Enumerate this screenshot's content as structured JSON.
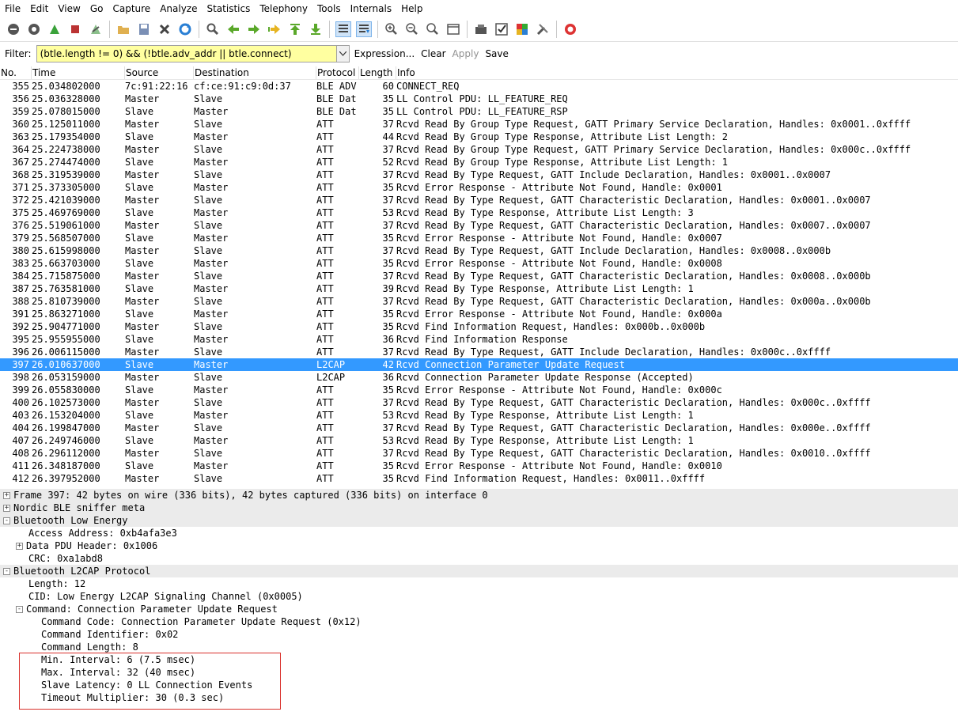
{
  "menu": [
    "File",
    "Edit",
    "View",
    "Go",
    "Capture",
    "Analyze",
    "Statistics",
    "Telephony",
    "Tools",
    "Internals",
    "Help"
  ],
  "toolbar_icons": [
    "interface-list-icon",
    "capture-options-icon",
    "start-capture-icon",
    "stop-capture-icon",
    "restart-capture-icon",
    "open-file-icon",
    "save-file-icon",
    "close-file-icon",
    "reload-icon",
    "find-icon",
    "go-back-icon",
    "go-forward-icon",
    "go-to-packet-icon",
    "first-packet-icon",
    "last-packet-icon",
    "colorize-icon",
    "autoscroll-icon",
    "zoom-in-icon",
    "zoom-out-icon",
    "normal-size-icon",
    "resize-columns-icon",
    "capture-filters-icon",
    "display-filters-icon",
    "coloring-rules-icon",
    "preferences-icon",
    "help-icon"
  ],
  "filter": {
    "label": "Filter:",
    "value": "(btle.length != 0) && (!btle.adv_addr || btle.connect)",
    "expression": "Expression...",
    "clear": "Clear",
    "apply": "Apply",
    "save": "Save"
  },
  "columns": {
    "no": "No.",
    "time": "Time",
    "source": "Source",
    "destination": "Destination",
    "protocol": "Protocol",
    "length": "Length",
    "info": "Info"
  },
  "packets": [
    {
      "no": "355",
      "time": "25.034802000",
      "src": "7c:91:22:16",
      "dst": "cf:ce:91:c9:0d:37",
      "proto": "BLE ADV",
      "len": "60",
      "info": "CONNECT_REQ"
    },
    {
      "no": "356",
      "time": "25.036328000",
      "src": "Master",
      "dst": "Slave",
      "proto": "BLE Dat",
      "len": "35",
      "info": "LL Control PDU: LL_FEATURE_REQ"
    },
    {
      "no": "359",
      "time": "25.078015000",
      "src": "Slave",
      "dst": "Master",
      "proto": "BLE Dat",
      "len": "35",
      "info": "LL Control PDU: LL_FEATURE_RSP"
    },
    {
      "no": "360",
      "time": "25.125011000",
      "src": "Master",
      "dst": "Slave",
      "proto": "ATT",
      "len": "37",
      "info": "Rcvd Read By Group Type Request, GATT Primary Service Declaration, Handles: 0x0001..0xffff"
    },
    {
      "no": "363",
      "time": "25.179354000",
      "src": "Slave",
      "dst": "Master",
      "proto": "ATT",
      "len": "44",
      "info": "Rcvd Read By Group Type Response, Attribute List Length: 2"
    },
    {
      "no": "364",
      "time": "25.224738000",
      "src": "Master",
      "dst": "Slave",
      "proto": "ATT",
      "len": "37",
      "info": "Rcvd Read By Group Type Request, GATT Primary Service Declaration, Handles: 0x000c..0xffff"
    },
    {
      "no": "367",
      "time": "25.274474000",
      "src": "Slave",
      "dst": "Master",
      "proto": "ATT",
      "len": "52",
      "info": "Rcvd Read By Group Type Response, Attribute List Length: 1"
    },
    {
      "no": "368",
      "time": "25.319539000",
      "src": "Master",
      "dst": "Slave",
      "proto": "ATT",
      "len": "37",
      "info": "Rcvd Read By Type Request, GATT Include Declaration, Handles: 0x0001..0x0007"
    },
    {
      "no": "371",
      "time": "25.373305000",
      "src": "Slave",
      "dst": "Master",
      "proto": "ATT",
      "len": "35",
      "info": "Rcvd Error Response - Attribute Not Found, Handle: 0x0001"
    },
    {
      "no": "372",
      "time": "25.421039000",
      "src": "Master",
      "dst": "Slave",
      "proto": "ATT",
      "len": "37",
      "info": "Rcvd Read By Type Request, GATT Characteristic Declaration, Handles: 0x0001..0x0007"
    },
    {
      "no": "375",
      "time": "25.469769000",
      "src": "Slave",
      "dst": "Master",
      "proto": "ATT",
      "len": "53",
      "info": "Rcvd Read By Type Response, Attribute List Length: 3"
    },
    {
      "no": "376",
      "time": "25.519061000",
      "src": "Master",
      "dst": "Slave",
      "proto": "ATT",
      "len": "37",
      "info": "Rcvd Read By Type Request, GATT Characteristic Declaration, Handles: 0x0007..0x0007"
    },
    {
      "no": "379",
      "time": "25.568507000",
      "src": "Slave",
      "dst": "Master",
      "proto": "ATT",
      "len": "35",
      "info": "Rcvd Error Response - Attribute Not Found, Handle: 0x0007"
    },
    {
      "no": "380",
      "time": "25.615998000",
      "src": "Master",
      "dst": "Slave",
      "proto": "ATT",
      "len": "37",
      "info": "Rcvd Read By Type Request, GATT Include Declaration, Handles: 0x0008..0x000b"
    },
    {
      "no": "383",
      "time": "25.663703000",
      "src": "Slave",
      "dst": "Master",
      "proto": "ATT",
      "len": "35",
      "info": "Rcvd Error Response - Attribute Not Found, Handle: 0x0008"
    },
    {
      "no": "384",
      "time": "25.715875000",
      "src": "Master",
      "dst": "Slave",
      "proto": "ATT",
      "len": "37",
      "info": "Rcvd Read By Type Request, GATT Characteristic Declaration, Handles: 0x0008..0x000b"
    },
    {
      "no": "387",
      "time": "25.763581000",
      "src": "Slave",
      "dst": "Master",
      "proto": "ATT",
      "len": "39",
      "info": "Rcvd Read By Type Response, Attribute List Length: 1"
    },
    {
      "no": "388",
      "time": "25.810739000",
      "src": "Master",
      "dst": "Slave",
      "proto": "ATT",
      "len": "37",
      "info": "Rcvd Read By Type Request, GATT Characteristic Declaration, Handles: 0x000a..0x000b"
    },
    {
      "no": "391",
      "time": "25.863271000",
      "src": "Slave",
      "dst": "Master",
      "proto": "ATT",
      "len": "35",
      "info": "Rcvd Error Response - Attribute Not Found, Handle: 0x000a"
    },
    {
      "no": "392",
      "time": "25.904771000",
      "src": "Master",
      "dst": "Slave",
      "proto": "ATT",
      "len": "35",
      "info": "Rcvd Find Information Request, Handles: 0x000b..0x000b"
    },
    {
      "no": "395",
      "time": "25.955955000",
      "src": "Slave",
      "dst": "Master",
      "proto": "ATT",
      "len": "36",
      "info": "Rcvd Find Information Response"
    },
    {
      "no": "396",
      "time": "26.006115000",
      "src": "Master",
      "dst": "Slave",
      "proto": "ATT",
      "len": "37",
      "info": "Rcvd Read By Type Request, GATT Include Declaration, Handles: 0x000c..0xffff"
    },
    {
      "no": "397",
      "time": "26.010637000",
      "src": "Slave",
      "dst": "Master",
      "proto": "L2CAP",
      "len": "42",
      "info": "Rcvd Connection Parameter Update Request",
      "selected": true
    },
    {
      "no": "398",
      "time": "26.053159000",
      "src": "Master",
      "dst": "Slave",
      "proto": "L2CAP",
      "len": "36",
      "info": "Rcvd Connection Parameter Update Response (Accepted)"
    },
    {
      "no": "399",
      "time": "26.055830000",
      "src": "Slave",
      "dst": "Master",
      "proto": "ATT",
      "len": "35",
      "info": "Rcvd Error Response - Attribute Not Found, Handle: 0x000c"
    },
    {
      "no": "400",
      "time": "26.102573000",
      "src": "Master",
      "dst": "Slave",
      "proto": "ATT",
      "len": "37",
      "info": "Rcvd Read By Type Request, GATT Characteristic Declaration, Handles: 0x000c..0xffff"
    },
    {
      "no": "403",
      "time": "26.153204000",
      "src": "Slave",
      "dst": "Master",
      "proto": "ATT",
      "len": "53",
      "info": "Rcvd Read By Type Response, Attribute List Length: 1"
    },
    {
      "no": "404",
      "time": "26.199847000",
      "src": "Master",
      "dst": "Slave",
      "proto": "ATT",
      "len": "37",
      "info": "Rcvd Read By Type Request, GATT Characteristic Declaration, Handles: 0x000e..0xffff"
    },
    {
      "no": "407",
      "time": "26.249746000",
      "src": "Slave",
      "dst": "Master",
      "proto": "ATT",
      "len": "53",
      "info": "Rcvd Read By Type Response, Attribute List Length: 1"
    },
    {
      "no": "408",
      "time": "26.296112000",
      "src": "Master",
      "dst": "Slave",
      "proto": "ATT",
      "len": "37",
      "info": "Rcvd Read By Type Request, GATT Characteristic Declaration, Handles: 0x0010..0xffff"
    },
    {
      "no": "411",
      "time": "26.348187000",
      "src": "Slave",
      "dst": "Master",
      "proto": "ATT",
      "len": "35",
      "info": "Rcvd Error Response - Attribute Not Found, Handle: 0x0010"
    },
    {
      "no": "412",
      "time": "26.397952000",
      "src": "Master",
      "dst": "Slave",
      "proto": "ATT",
      "len": "35",
      "info": "Rcvd Find Information Request, Handles: 0x0011..0xffff"
    }
  ],
  "details": [
    {
      "text": "Frame 397: 42 bytes on wire (336 bits), 42 bytes captured (336 bits) on interface 0",
      "level": 0,
      "toggle": "+",
      "top": true
    },
    {
      "text": "Nordic BLE sniffer meta",
      "level": 0,
      "toggle": "+",
      "top": true
    },
    {
      "text": "Bluetooth Low Energy",
      "level": 0,
      "toggle": "-",
      "top": true
    },
    {
      "text": "Access Address: 0xb4afa3e3",
      "level": 1,
      "toggle": ""
    },
    {
      "text": "Data PDU Header: 0x1006",
      "level": 1,
      "toggle": "+"
    },
    {
      "text": "CRC: 0xa1abd8",
      "level": 1,
      "toggle": ""
    },
    {
      "text": "Bluetooth L2CAP Protocol",
      "level": 0,
      "toggle": "-",
      "top": true
    },
    {
      "text": "Length: 12",
      "level": 1,
      "toggle": ""
    },
    {
      "text": "CID: Low Energy L2CAP Signaling Channel (0x0005)",
      "level": 1,
      "toggle": ""
    },
    {
      "text": "Command: Connection Parameter Update Request",
      "level": 1,
      "toggle": "-"
    },
    {
      "text": "Command Code: Connection Parameter Update Request (0x12)",
      "level": 2,
      "toggle": ""
    },
    {
      "text": "Command Identifier: 0x02",
      "level": 2,
      "toggle": ""
    },
    {
      "text": "Command Length: 8",
      "level": 2,
      "toggle": ""
    },
    {
      "text": "Min. Interval: 6 (7.5 msec)",
      "level": 2,
      "toggle": ""
    },
    {
      "text": "Max. Interval: 32 (40 msec)",
      "level": 2,
      "toggle": ""
    },
    {
      "text": "Slave Latency: 0 LL Connection Events",
      "level": 2,
      "toggle": ""
    },
    {
      "text": "Timeout Multiplier: 30 (0.3 sec)",
      "level": 2,
      "toggle": ""
    }
  ],
  "colors": {
    "selected_row": "#3399ff",
    "filter_bg": "#ffffa0",
    "highlight_box": "#d9302b"
  }
}
